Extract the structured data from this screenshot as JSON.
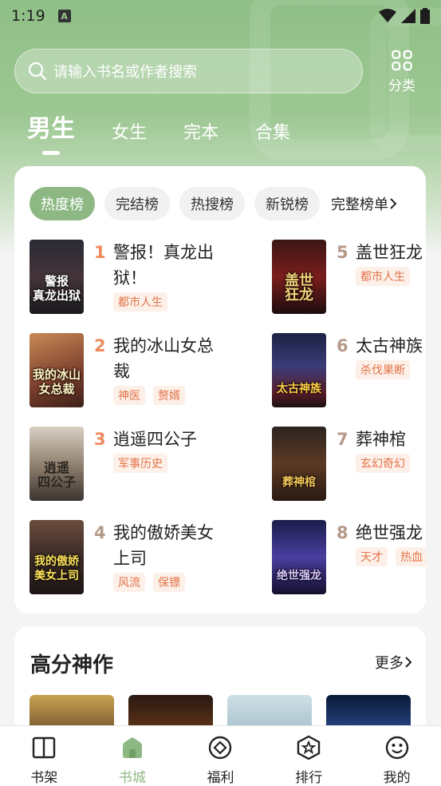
{
  "status_bar": {
    "time": "1:19",
    "notification_letter": "A"
  },
  "search": {
    "placeholder": "请输入书名或作者搜索"
  },
  "category": {
    "label": "分类"
  },
  "gender_tabs": [
    {
      "label": "男生",
      "active": true
    },
    {
      "label": "女生"
    },
    {
      "label": "完本"
    },
    {
      "label": "合集"
    }
  ],
  "rank_tabs": [
    {
      "label": "热度榜",
      "active": true
    },
    {
      "label": "完结榜"
    },
    {
      "label": "热搜榜"
    },
    {
      "label": "新锐榜"
    }
  ],
  "rank_full_label": "完整榜单",
  "books": [
    {
      "rank": "1",
      "title": "警报！真龙出狱！",
      "tags": [
        "都市人生"
      ],
      "cover_text": "警报\n真龙出狱"
    },
    {
      "rank": "2",
      "title": "我的冰山女总裁",
      "tags": [
        "神医",
        "赘婿"
      ],
      "cover_text": "我的冰山\n女总裁"
    },
    {
      "rank": "3",
      "title": "逍遥四公子",
      "tags": [
        "军事历史"
      ],
      "cover_text": "逍遥\n四公子"
    },
    {
      "rank": "4",
      "title": "我的傲娇美女上司",
      "tags": [
        "风流",
        "保镖"
      ],
      "cover_text": "我的傲娇\n美女上司"
    },
    {
      "rank": "5",
      "title": "盖世狂龙",
      "tags": [
        "都市人生"
      ],
      "cover_text": "盖世\n狂龙"
    },
    {
      "rank": "6",
      "title": "太古神族",
      "tags": [
        "杀伐果断"
      ],
      "cover_text": "太古神族"
    },
    {
      "rank": "7",
      "title": "葬神棺",
      "tags": [
        "玄幻奇幻"
      ],
      "cover_text": "葬神棺"
    },
    {
      "rank": "8",
      "title": "绝世强龙",
      "tags": [
        "天才",
        "热血"
      ],
      "cover_text": "绝世强龙"
    }
  ],
  "high_score": {
    "title": "高分神作",
    "more_label": "更多"
  },
  "bottom_nav": [
    {
      "label": "书架",
      "icon": "book-icon"
    },
    {
      "label": "书城",
      "icon": "home-icon",
      "active": true
    },
    {
      "label": "福利",
      "icon": "diamond-icon"
    },
    {
      "label": "排行",
      "icon": "star-badge-icon"
    },
    {
      "label": "我的",
      "icon": "smile-icon"
    }
  ],
  "colors": {
    "accent": "#8db884",
    "rank_top": "#f08a5d",
    "rank_other": "#b59a8a",
    "tag_text": "#e2744a",
    "tag_bg": "#fdf0e8"
  }
}
